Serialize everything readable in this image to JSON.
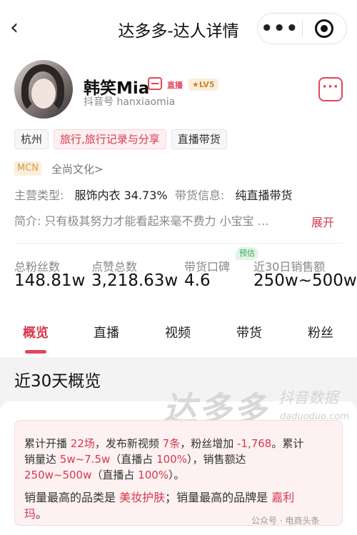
{
  "header": {
    "title": "达多多-达人详情",
    "back_icon": "chevron-left-icon",
    "more_label": "•••"
  },
  "profile": {
    "name": "韩笑Mia",
    "live_badge": "直播",
    "level": "LV5",
    "douyin_id": "抖音号 hanxiaomia",
    "more_label": "···"
  },
  "tags": [
    "杭州",
    "旅行,旅行记录与分享",
    "直播带货"
  ],
  "mcn": {
    "badge": "MCN",
    "name": "全尚文化>"
  },
  "info": {
    "main_type_label": "主营类型:",
    "main_type_value": "服饰内衣 34.73%",
    "goods_label": "带货信息:",
    "goods_value": "纯直播带货",
    "intro": "简介:  只有极其努力才能看起来毫不费力  小宝宝  …",
    "expand": "展开"
  },
  "stats": {
    "predict_badge": "预估",
    "items": [
      {
        "label": "总粉丝数",
        "value": "148.81w"
      },
      {
        "label": "点赞总数",
        "value": "3,218.63w"
      },
      {
        "label": "带货口碑",
        "value": "4.6"
      },
      {
        "label": "近30日销售额",
        "value": "250w~500w"
      }
    ]
  },
  "tabs": [
    "概览",
    "直播",
    "视频",
    "带货",
    "粉丝"
  ],
  "overview": {
    "title": "近30天概览",
    "watermark_main": "达多多",
    "watermark_side": "抖音数据",
    "watermark_url": "daduoduo.com",
    "line1_a": "累计开播 ",
    "line1_b": "22场",
    "line1_c": "，发布新视频 ",
    "line1_d": "7条",
    "line1_e": "，粉丝增加 ",
    "line1_f": "-1,768",
    "line1_g": "。累计",
    "line2_a": "销量达 ",
    "line2_b": "5w~7.5w",
    "line2_c": "（直播占 ",
    "line2_d": "100%",
    "line2_e": "），销售额达",
    "line3_a": "250w~500w",
    "line3_b": "（直播占 ",
    "line3_c": "100%",
    "line3_d": "）。",
    "line4_a": "销量最高的品类是 ",
    "line4_b": "美妆护肤",
    "line4_c": "；销量最高的品牌是 ",
    "line4_d": "嘉利",
    "line5_a": "玛",
    "line5_b": "。"
  },
  "footer_note": "公众号 · 电商头条"
}
